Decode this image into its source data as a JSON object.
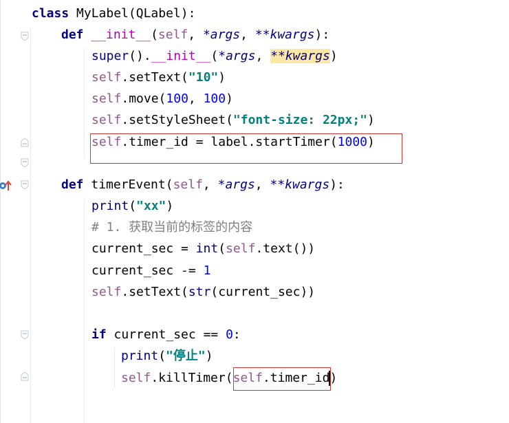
{
  "lines": [
    {
      "id": "l1",
      "tokens": [
        "class",
        " ",
        "MyLabel",
        "(",
        "QLabel",
        "):"
      ]
    },
    {
      "id": "l2",
      "tokens": [
        "def",
        " ",
        "__init__",
        "(",
        "self",
        ", ",
        "*args",
        ", ",
        "**kwargs",
        "):"
      ]
    },
    {
      "id": "l3",
      "tokens": [
        "super",
        "().",
        "__init__",
        "(",
        "*args",
        ", ",
        "**kwargs",
        ")"
      ]
    },
    {
      "id": "l4",
      "tokens": [
        "self",
        ".setText(",
        "\"10\"",
        ")"
      ]
    },
    {
      "id": "l5",
      "tokens": [
        "self",
        ".move(",
        "100",
        ", ",
        "100",
        ")"
      ]
    },
    {
      "id": "l6",
      "tokens": [
        "self",
        ".setStyleSheet(",
        "\"font-size: 22px;\"",
        ")"
      ]
    },
    {
      "id": "l7",
      "tokens": [
        "self",
        ".timer_id = label.startTimer(",
        "1000",
        ")"
      ]
    },
    {
      "id": "l9",
      "tokens": [
        "def",
        " timerEvent(",
        "self",
        ", ",
        "*args",
        ", ",
        "**kwargs",
        "):"
      ]
    },
    {
      "id": "l10",
      "tokens": [
        "print",
        "(",
        "\"xx\"",
        ")"
      ]
    },
    {
      "id": "l11",
      "tokens": [
        "# 1. 获取当前的标签的内容"
      ]
    },
    {
      "id": "l12",
      "tokens": [
        "current_sec = ",
        "int",
        "(",
        "self",
        ".text())"
      ]
    },
    {
      "id": "l13",
      "tokens": [
        "current_sec -= ",
        "1"
      ]
    },
    {
      "id": "l14",
      "tokens": [
        "self",
        ".setText(",
        "str",
        "(current_sec))"
      ]
    },
    {
      "id": "l16",
      "tokens": [
        "if",
        " current_sec == ",
        "0",
        ":"
      ]
    },
    {
      "id": "l17",
      "tokens": [
        "print",
        "(",
        "\"停止\"",
        ")"
      ]
    },
    {
      "id": "l18",
      "tokens": [
        "self",
        ".killTimer(",
        "self",
        ".timer_id)"
      ]
    }
  ],
  "colors": {
    "keyword": "#000080",
    "self": "#94558D",
    "string": "#008080",
    "number": "#0000FF",
    "comment": "#808080",
    "magic": "#B200B2",
    "annotation_box": "#D2352F",
    "highlight": "#FFE8A6"
  },
  "icons": {
    "override": "override-gutter-icon",
    "fold": "fold-marker-icon"
  }
}
